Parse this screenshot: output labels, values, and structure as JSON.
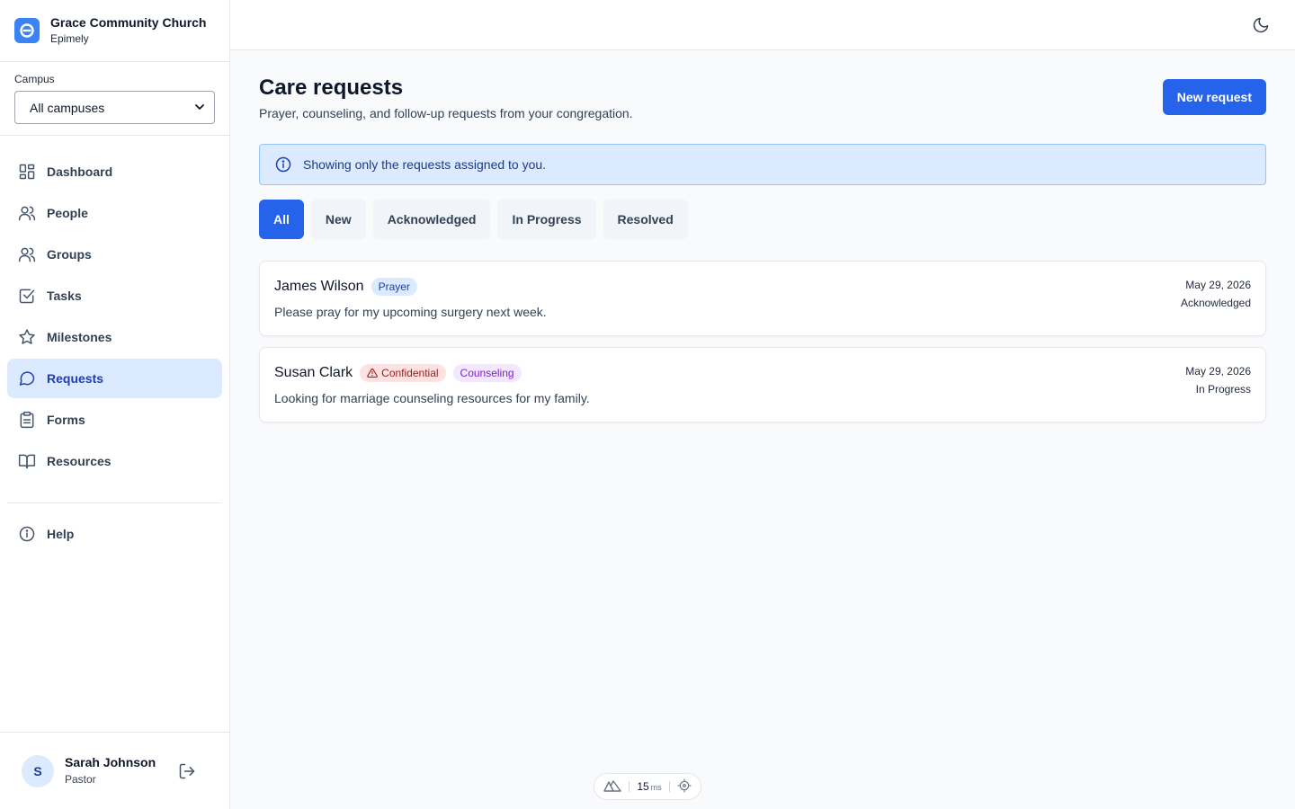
{
  "brand": {
    "name": "Grace Community Church",
    "sub": "Epimely"
  },
  "campus": {
    "label": "Campus",
    "selected": "All campuses"
  },
  "nav": {
    "items": [
      {
        "label": "Dashboard",
        "icon": "dashboard-icon"
      },
      {
        "label": "People",
        "icon": "people-icon"
      },
      {
        "label": "Groups",
        "icon": "groups-icon"
      },
      {
        "label": "Tasks",
        "icon": "tasks-icon"
      },
      {
        "label": "Milestones",
        "icon": "star-icon"
      },
      {
        "label": "Requests",
        "icon": "message-icon",
        "active": true
      },
      {
        "label": "Forms",
        "icon": "clipboard-icon"
      },
      {
        "label": "Resources",
        "icon": "book-icon"
      }
    ],
    "help": {
      "label": "Help",
      "icon": "info-icon"
    }
  },
  "user": {
    "initial": "S",
    "name": "Sarah Johnson",
    "role": "Pastor"
  },
  "page": {
    "title": "Care requests",
    "subtitle": "Prayer, counseling, and follow-up requests from your congregation.",
    "new_button": "New request"
  },
  "banner": {
    "text": "Showing only the requests assigned to you."
  },
  "filters": [
    "All",
    "New",
    "Acknowledged",
    "In Progress",
    "Resolved"
  ],
  "active_filter": "All",
  "requests": [
    {
      "name": "James Wilson",
      "tags": [
        {
          "label": "Prayer",
          "kind": "prayer"
        }
      ],
      "description": "Please pray for my upcoming surgery next week.",
      "date": "May 29, 2026",
      "status": "Acknowledged"
    },
    {
      "name": "Susan Clark",
      "tags": [
        {
          "label": "Confidential",
          "kind": "confidential"
        },
        {
          "label": "Counseling",
          "kind": "counseling"
        }
      ],
      "description": "Looking for marriage counseling resources for my family.",
      "date": "May 29, 2026",
      "status": "In Progress"
    }
  ],
  "perf": {
    "value": "15",
    "unit": "ms"
  },
  "colors": {
    "primary": "#2563eb",
    "active_nav_bg": "#dbeafe",
    "banner_bg": "#dbeafe"
  }
}
